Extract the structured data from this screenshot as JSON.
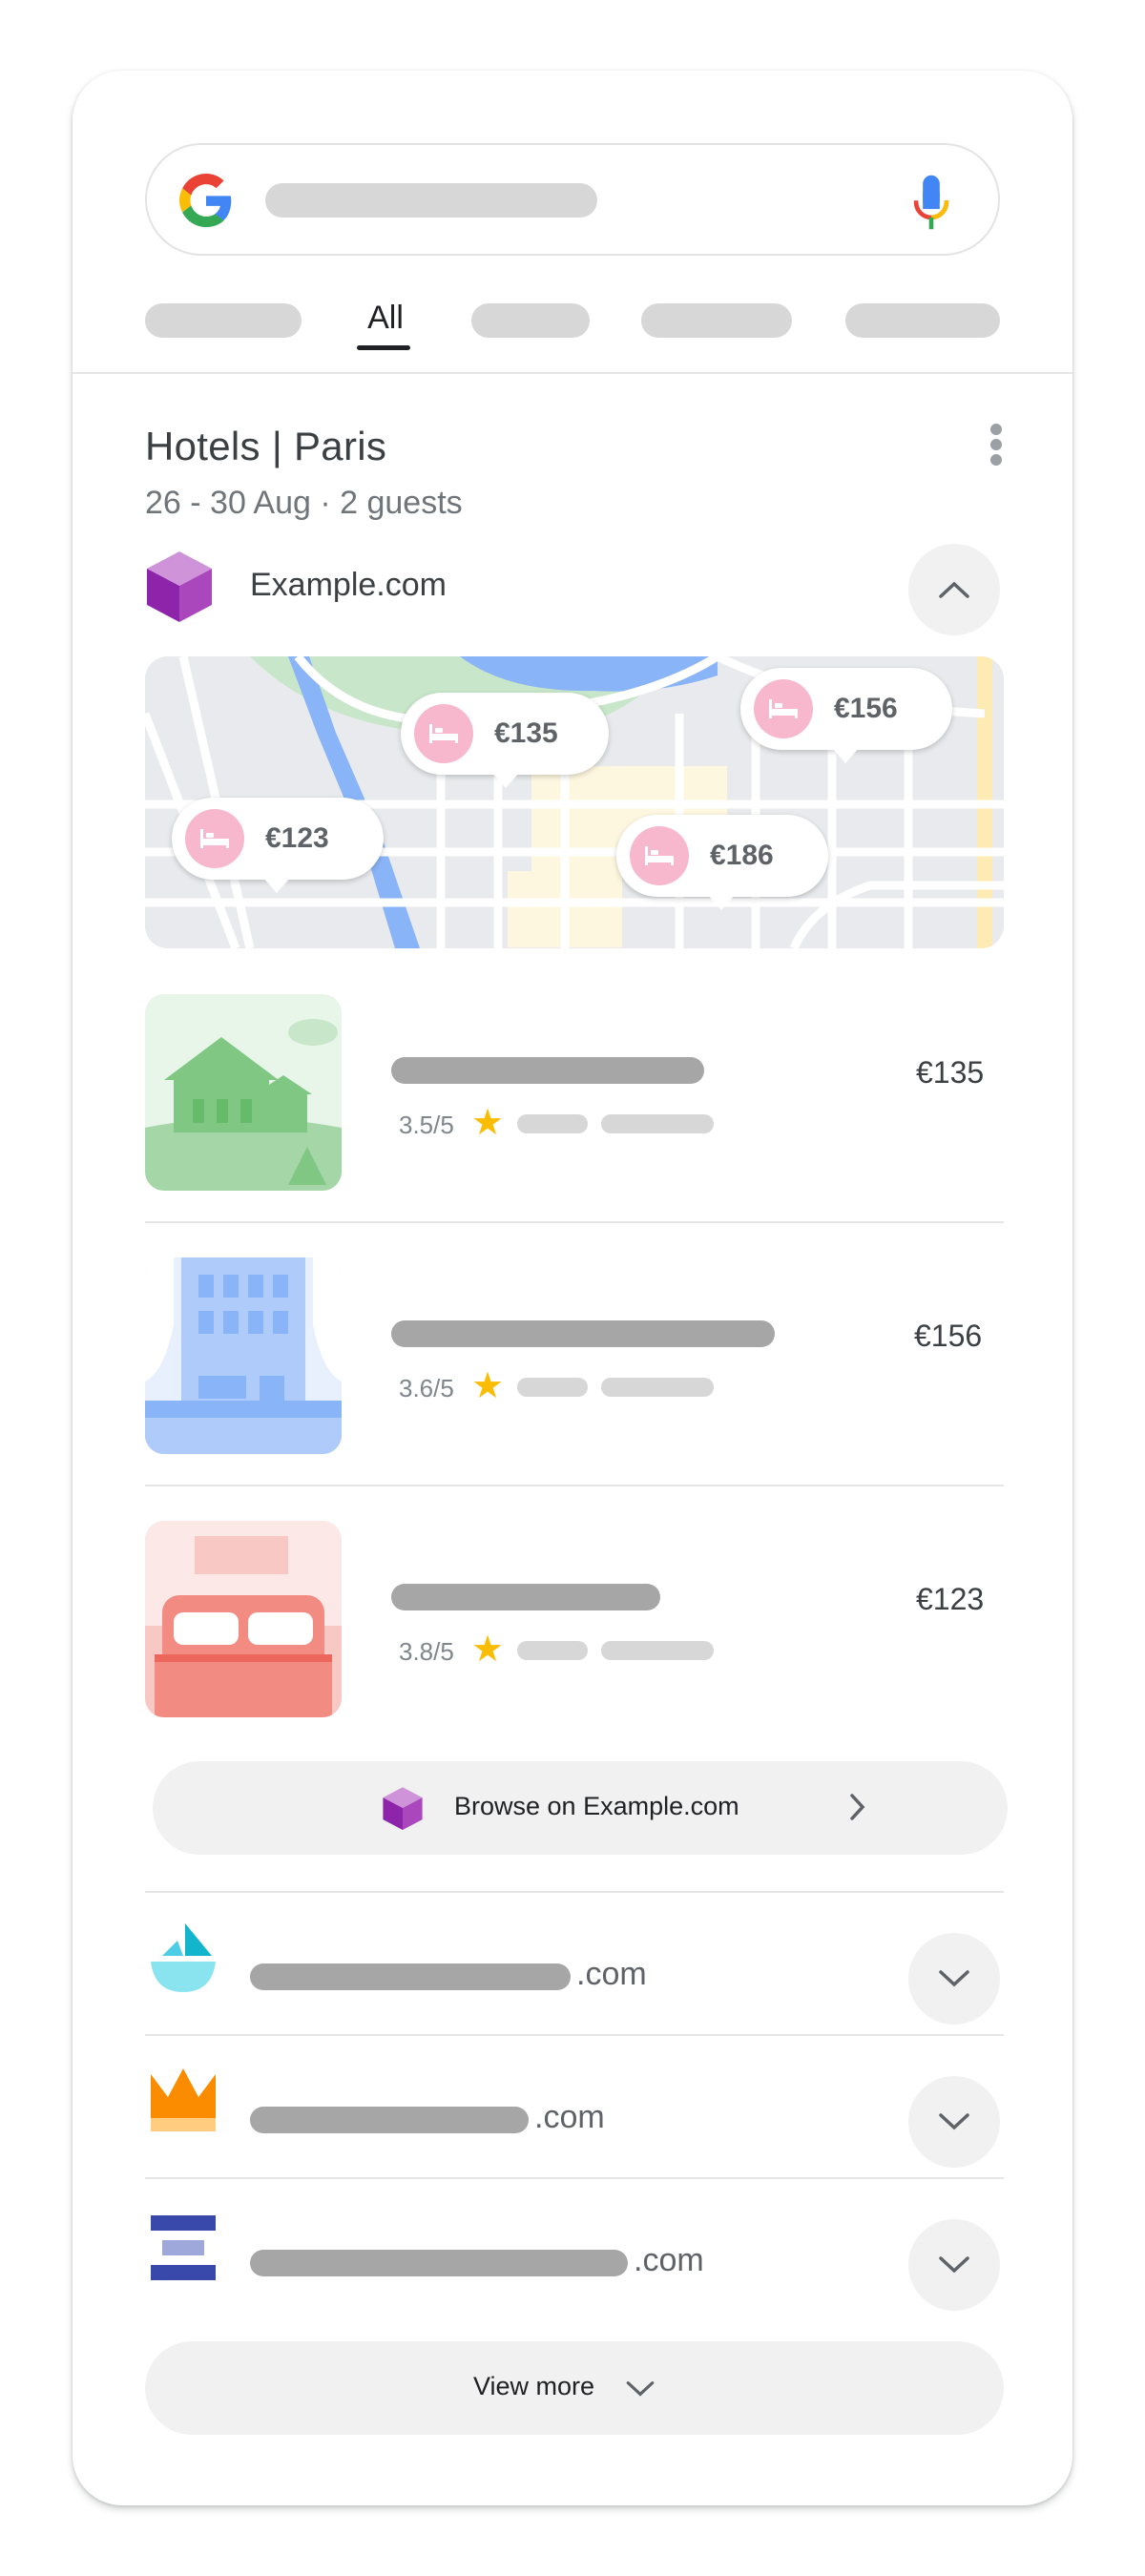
{
  "tabs": {
    "active_label": "All"
  },
  "header": {
    "title": "Hotels | Paris",
    "subtitle": "26 - 30 Aug · 2 guests"
  },
  "provider": {
    "name": "Example.com"
  },
  "map": {
    "pins": [
      {
        "price": "€135"
      },
      {
        "price": "€156"
      },
      {
        "price": "€123"
      },
      {
        "price": "€186"
      }
    ]
  },
  "hotels": [
    {
      "rating": "3.5/5",
      "price": "€135"
    },
    {
      "rating": "3.6/5",
      "price": "€156"
    },
    {
      "rating": "3.8/5",
      "price": "€123"
    }
  ],
  "browse": {
    "label": "Browse on Example.com"
  },
  "other_providers": [
    {
      "suffix": ".com",
      "logo": "sailboat-icon"
    },
    {
      "suffix": ".com",
      "logo": "crown-icon"
    },
    {
      "suffix": ".com",
      "logo": "stacked-bars-icon"
    }
  ],
  "view_more": {
    "label": "View more"
  },
  "colors": {
    "accent_pink": "#f7b7cc",
    "star": "#fbbc04",
    "provider_purple": "#9c27b0"
  }
}
